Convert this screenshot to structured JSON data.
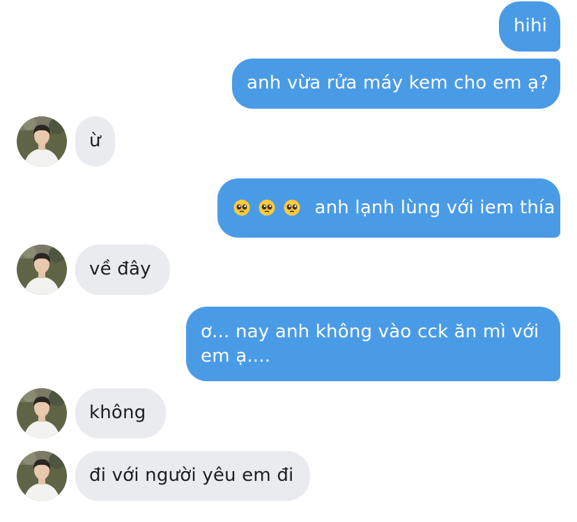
{
  "messages": [
    {
      "id": "m1",
      "direction": "outgoing",
      "text": "hihi"
    },
    {
      "id": "m2",
      "direction": "outgoing",
      "text": "anh vừa rửa máy kem cho em ạ?"
    },
    {
      "id": "m3",
      "direction": "incoming",
      "text": "ừ"
    },
    {
      "id": "m4",
      "direction": "outgoing",
      "emoji": [
        "pleading-face",
        "pleading-face",
        "pleading-face"
      ],
      "text": "anh lạnh lùng với iem thía"
    },
    {
      "id": "m5",
      "direction": "incoming",
      "text": "về đây"
    },
    {
      "id": "m6",
      "direction": "outgoing",
      "text": "ơ... nay anh không vào cck ăn mì với em ạ...."
    },
    {
      "id": "m7",
      "direction": "incoming",
      "text": "không"
    },
    {
      "id": "m8",
      "direction": "incoming",
      "text": "đi với người yêu em đi"
    }
  ],
  "colors": {
    "outgoing_bubble": "#4a9be6",
    "incoming_bubble": "#e9ebef",
    "outgoing_text": "#ffffff",
    "incoming_text": "#1c1e21"
  },
  "icons": {
    "avatar": "contact-avatar",
    "emoji": "pleading-face-emoji"
  }
}
